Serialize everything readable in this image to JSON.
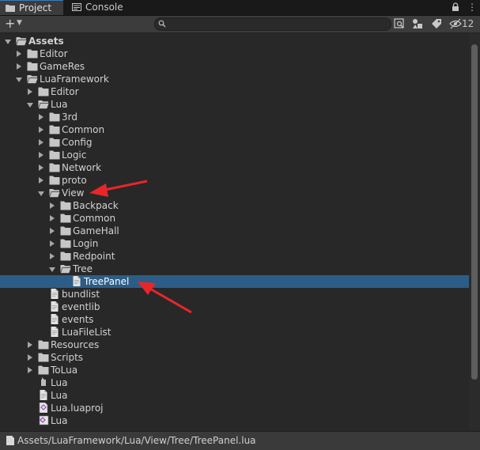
{
  "tabs": [
    {
      "label": "Project",
      "active": true,
      "icon": "folder-icon"
    },
    {
      "label": "Console",
      "active": false,
      "icon": "console-icon"
    }
  ],
  "tab_menu": {
    "lock": "lock-icon",
    "more": "⋮"
  },
  "toolbar": {
    "plus": "+",
    "search_placeholder": "",
    "hidden_count": "12"
  },
  "tree": [
    {
      "label": "Assets",
      "depth": 0,
      "type": "folder",
      "expanded": true,
      "root": true
    },
    {
      "label": "Editor",
      "depth": 1,
      "type": "folder",
      "expanded": false
    },
    {
      "label": "GameRes",
      "depth": 1,
      "type": "folder",
      "expanded": false
    },
    {
      "label": "LuaFramework",
      "depth": 1,
      "type": "folder",
      "expanded": true
    },
    {
      "label": "Editor",
      "depth": 2,
      "type": "folder",
      "expanded": false
    },
    {
      "label": "Lua",
      "depth": 2,
      "type": "folder",
      "expanded": true
    },
    {
      "label": "3rd",
      "depth": 3,
      "type": "folder",
      "expanded": false
    },
    {
      "label": "Common",
      "depth": 3,
      "type": "folder",
      "expanded": false
    },
    {
      "label": "Config",
      "depth": 3,
      "type": "folder",
      "expanded": false
    },
    {
      "label": "Logic",
      "depth": 3,
      "type": "folder",
      "expanded": false
    },
    {
      "label": "Network",
      "depth": 3,
      "type": "folder",
      "expanded": false
    },
    {
      "label": "proto",
      "depth": 3,
      "type": "folder",
      "expanded": false
    },
    {
      "label": "View",
      "depth": 3,
      "type": "folder",
      "expanded": true
    },
    {
      "label": "Backpack",
      "depth": 4,
      "type": "folder",
      "expanded": false
    },
    {
      "label": "Common",
      "depth": 4,
      "type": "folder",
      "expanded": false
    },
    {
      "label": "GameHall",
      "depth": 4,
      "type": "folder",
      "expanded": false
    },
    {
      "label": "Login",
      "depth": 4,
      "type": "folder",
      "expanded": false
    },
    {
      "label": "Redpoint",
      "depth": 4,
      "type": "folder",
      "expanded": false
    },
    {
      "label": "Tree",
      "depth": 4,
      "type": "folder",
      "expanded": true
    },
    {
      "label": "TreePanel",
      "depth": 5,
      "type": "file",
      "selected": true
    },
    {
      "label": "bundlist",
      "depth": 3,
      "type": "file"
    },
    {
      "label": "eventlib",
      "depth": 3,
      "type": "file"
    },
    {
      "label": "events",
      "depth": 3,
      "type": "file"
    },
    {
      "label": "LuaFileList",
      "depth": 3,
      "type": "file"
    },
    {
      "label": "Resources",
      "depth": 2,
      "type": "folder",
      "expanded": false
    },
    {
      "label": "Scripts",
      "depth": 2,
      "type": "folder",
      "expanded": false
    },
    {
      "label": "ToLua",
      "depth": 2,
      "type": "folder",
      "expanded": false
    },
    {
      "label": "Lua",
      "depth": 2,
      "type": "unity-asset"
    },
    {
      "label": "Lua",
      "depth": 2,
      "type": "file-white"
    },
    {
      "label": "Lua.luaproj",
      "depth": 2,
      "type": "vs-project"
    },
    {
      "label": "Lua",
      "depth": 2,
      "type": "vs-solution"
    }
  ],
  "status": {
    "path": "Assets/LuaFramework/Lua/View/Tree/TreePanel.lua"
  },
  "colors": {
    "selection": "#2c5d87",
    "annotation_arrow": "#e8262a"
  }
}
